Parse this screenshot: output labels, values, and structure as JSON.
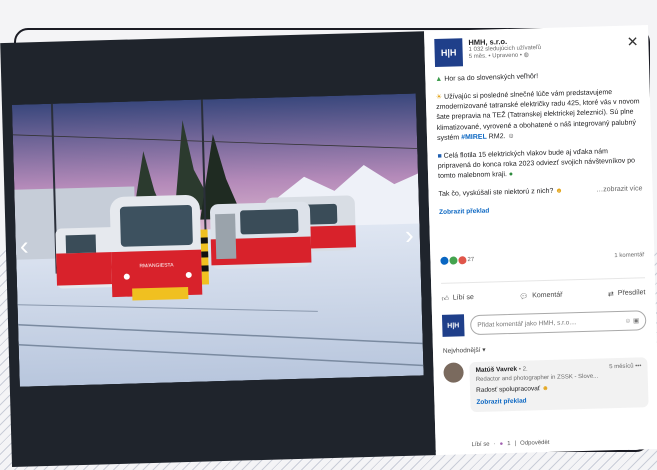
{
  "post": {
    "company_name": "HMH, s.r.o.",
    "logo_text": "H|H",
    "followers": "1 032 sledujúcich užívateľů",
    "meta": "5 měs. • Upraveno •",
    "line1": "Hor sa do slovenských veľhôr!",
    "para1": "Užívajúc si posledné slnečné lúče vám predstavujeme zmodernizované tatranské električky radu 425, ktoré vás v novom šate prepravia na TEŽ (Tatranskej elektrickej železnici). Sú plne klimatizované, vyrovené a obohatené o náš integrovaný palubný systém",
    "hashtag": "#MIREL",
    "para1_end": "RM2.",
    "para2": "Celá flotila 15 elektrických vlakov bude aj vďaka nám pripravená do konca roka 2023 odviezť svojich návštevníkov po tomto malebnom kraji.",
    "question": "Tak čo, vyskúšali ste niektorú z nich?",
    "see_more": "…zobrazit více",
    "translate": "Zobrazit překlad",
    "reaction_count": "27",
    "comment_count": "1 komentář",
    "train_label": "RM/ANGIESTA"
  },
  "actions": {
    "like": "Líbí se",
    "comment": "Komentář",
    "share": "Přesdílet"
  },
  "comment_input": {
    "placeholder": "Přidat komentář jako HMH, s.r.o...."
  },
  "sort_label": "Nejvhodnější ▾",
  "comment": {
    "author": "Matúš Vavrek",
    "degree": "• 2.",
    "time": "5 měsíců •••",
    "headline": "Redactor and photographer in ZSSK - Slove...",
    "text": "Radosť spolupracovať",
    "translate": "Zobrazit překlad",
    "like": "Líbí se",
    "likes": "1",
    "reply": "Odpovědět"
  },
  "colors": {
    "linkedin_blue": "#0a66c2",
    "brand_navy": "#1f3f8a",
    "train_red": "#d8222b"
  }
}
